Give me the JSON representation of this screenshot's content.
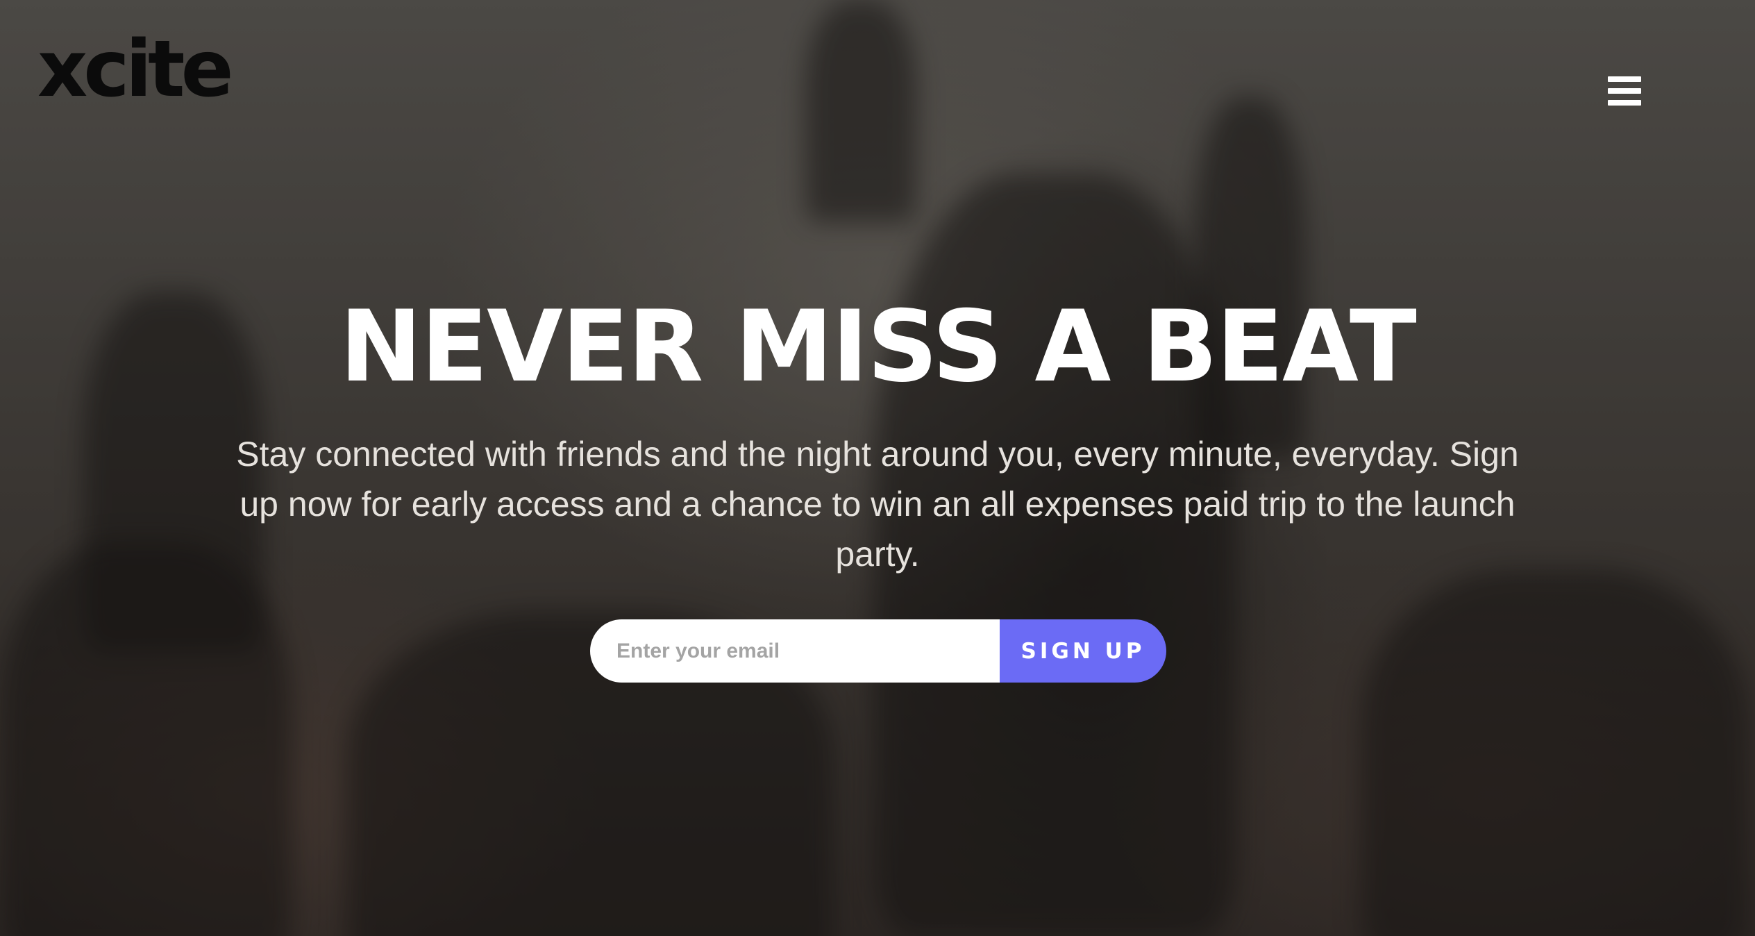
{
  "header": {
    "logo_text": "xcite",
    "menu_icon": "hamburger-menu-icon"
  },
  "hero": {
    "headline": "NEVER MISS A BEAT",
    "subtext": "Stay connected with friends and the night around you, every minute, everyday. Sign up now for early access and a chance to win an all expenses paid trip to the launch party.",
    "background": "dark hazy concert crowd photo"
  },
  "signup": {
    "email_placeholder": "Enter your email",
    "email_value": "",
    "button_label": "SIGN UP"
  },
  "colors": {
    "accent": "#6b6bf5",
    "headline": "#ffffff",
    "logo": "#0b0b0b",
    "input_bg": "#ffffff",
    "placeholder": "#a4a4a4"
  }
}
